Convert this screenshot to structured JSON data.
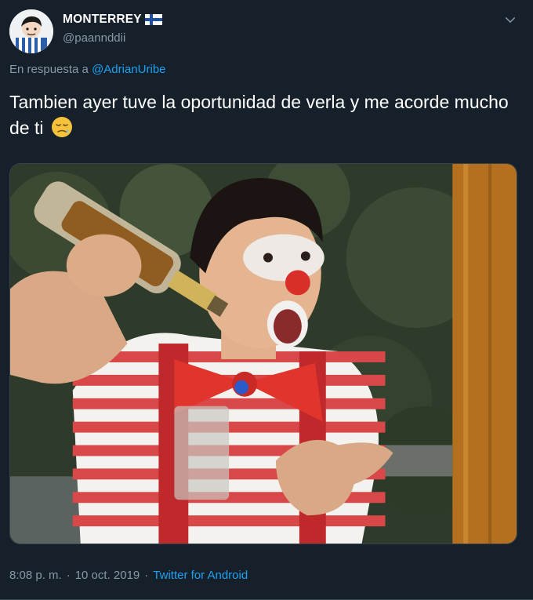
{
  "user": {
    "display_name": "MONTERREY",
    "handle": "@paannddii",
    "flag_icon": "finland-flag-icon",
    "avatar_icon": "cartoon-avatar-icon"
  },
  "reply": {
    "prefix": "En respuesta a",
    "mention": "@AdrianUribe"
  },
  "tweet": {
    "text": "Tambien ayer tuve la oportunidad de verla y me acorde mucho de ti",
    "emoji_icon": "sleepy-face-emoji-icon"
  },
  "media": {
    "icon": "photo-clown-with-bottle"
  },
  "footer": {
    "time": "8:08 p. m.",
    "sep1": "·",
    "date": "10 oct. 2019",
    "sep2": "·",
    "source": "Twitter for Android"
  },
  "colors": {
    "background": "#15202b",
    "secondary_text": "#8899a6",
    "link": "#1da1f2",
    "border": "#38444d"
  }
}
